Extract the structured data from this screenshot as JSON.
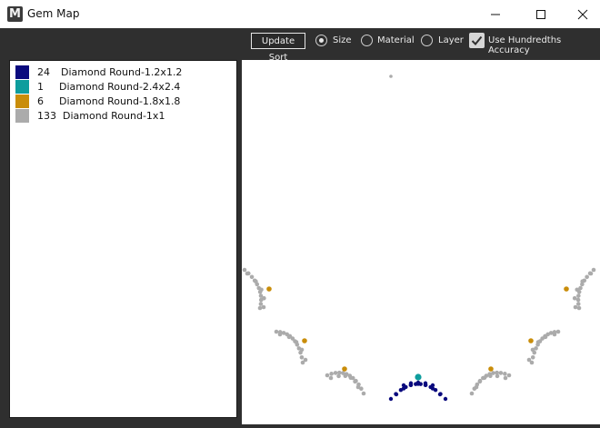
{
  "window": {
    "title": "Gem Map",
    "icon": "M"
  },
  "toolbar": {
    "update_label": "Update Sort",
    "size_label": "Size",
    "material_label": "Material",
    "layer_label": "Layer",
    "accuracy_label": "Use Hundredths Accuracy",
    "sort_selected": "Size",
    "accuracy_checked": true
  },
  "legend": [
    {
      "count": "24",
      "name": "Diamond Round-1.2x1.2",
      "color": "#0a0a7e"
    },
    {
      "count": "1",
      "name": "Diamond Round-2.4x2.4",
      "color": "#0e9d9d"
    },
    {
      "count": "6",
      "name": "Diamond Round-1.8x1.8",
      "color": "#c98d0a"
    },
    {
      "count": "133",
      "name": "Diamond Round-1x1",
      "color": "#ababab"
    }
  ],
  "colors": {
    "titlebar": "#ffffff",
    "toolbar": "#2f2f2f",
    "panel": "#ffffff"
  },
  "icons": [
    "minimize-icon",
    "maximize-icon",
    "close-icon",
    "checkmark-icon",
    "app-logo-icon"
  ]
}
